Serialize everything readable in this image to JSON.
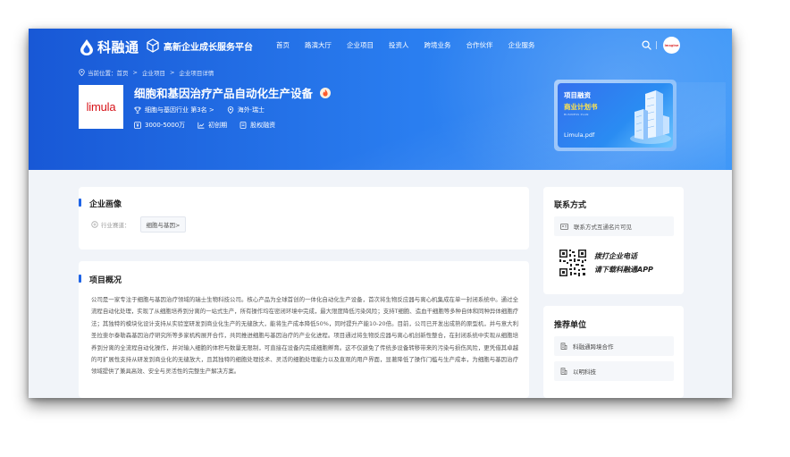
{
  "header": {
    "brand": "科融通",
    "platform": "高新企业成长服务平台",
    "nav": [
      "首页",
      "路演大厅",
      "企业项目",
      "投资人",
      "跨境业务",
      "合作伙伴",
      "企业服务"
    ],
    "avatar_text": "imagine"
  },
  "breadcrumb": [
    "当前位置：首页",
    "企业项目",
    "企业项目详情"
  ],
  "project": {
    "logo_text": "limula",
    "title": "细胞和基因治疗产品自动化生产设备",
    "industry_rank": "细胞与基因行业  第3名 >",
    "location": "海外·瑞士",
    "funding": "3000-5000万",
    "stage": "初创期",
    "type": "股权融资"
  },
  "bp_card": {
    "title": "项目融资",
    "subtitle": "商业计划书",
    "en": "BUSINESS PLAN",
    "file": "Limula.pdf"
  },
  "profile": {
    "section_title": "企业画像",
    "track_label": "行业赛道：",
    "track_tag": "细胞与基因>"
  },
  "overview": {
    "section_title": "项目概况",
    "text": "公司是一家专注于细胞与基因治疗领域的瑞士生物科技公司。核心产品为全球首创的一体化自动化生产设备，首次将生物反应器与离心机集成在单一封闭系统中。通过全流程自动化处理，实现了从细胞培养到分离的一站式生产，所有操作均在密闭环境中完成，最大限度降低污染风险；支持T细胞、造血干细胞等多种自体和同种异体细胞疗法；其独特的模块化设计支持从实验室研发到商业化生产的无缝放大，能将生产成本降低50%，同时提升产能10-20倍。目前，公司已开发出成熟的原型机，并与意大利圣拉斐尔泰勒森基因治疗研究所等多家机构展开合作，共同推进细胞与基因治疗的产业化进程。项目通过将生物反应器与离心机创新性整合，在封闭系统中实现从细胞培养到分离的全流程自动化操作，并对输入细胞的体积与数量无限制，可直接在设备内完成细胞孵育。这不仅避免了传统多设备转移带来的污染与损伤风险，更凭借其卓越的可扩展性支持从研发到商业化的无缝放大，且其独特的细胞处理技术、灵活的细胞处理能力以及直观的用户界面，显著降低了操作门槛与生产成本，为细胞与基因治疗领域提供了兼具高效、安全与灵活性的完整生产解决方案。"
  },
  "contact": {
    "section_title": "联系方式",
    "card_row": "联系方式互通名片可见",
    "qr_line1": "拨打企业电话",
    "qr_line2": "请下载科融通APP"
  },
  "recommend": {
    "section_title": "推荐单位",
    "items": [
      "科融通跨境合作",
      "以明科技"
    ]
  },
  "colors": {
    "hero_blue": "#1f64e6",
    "bp_highlight": "#ffe34d",
    "logo_red": "#d7141a"
  }
}
